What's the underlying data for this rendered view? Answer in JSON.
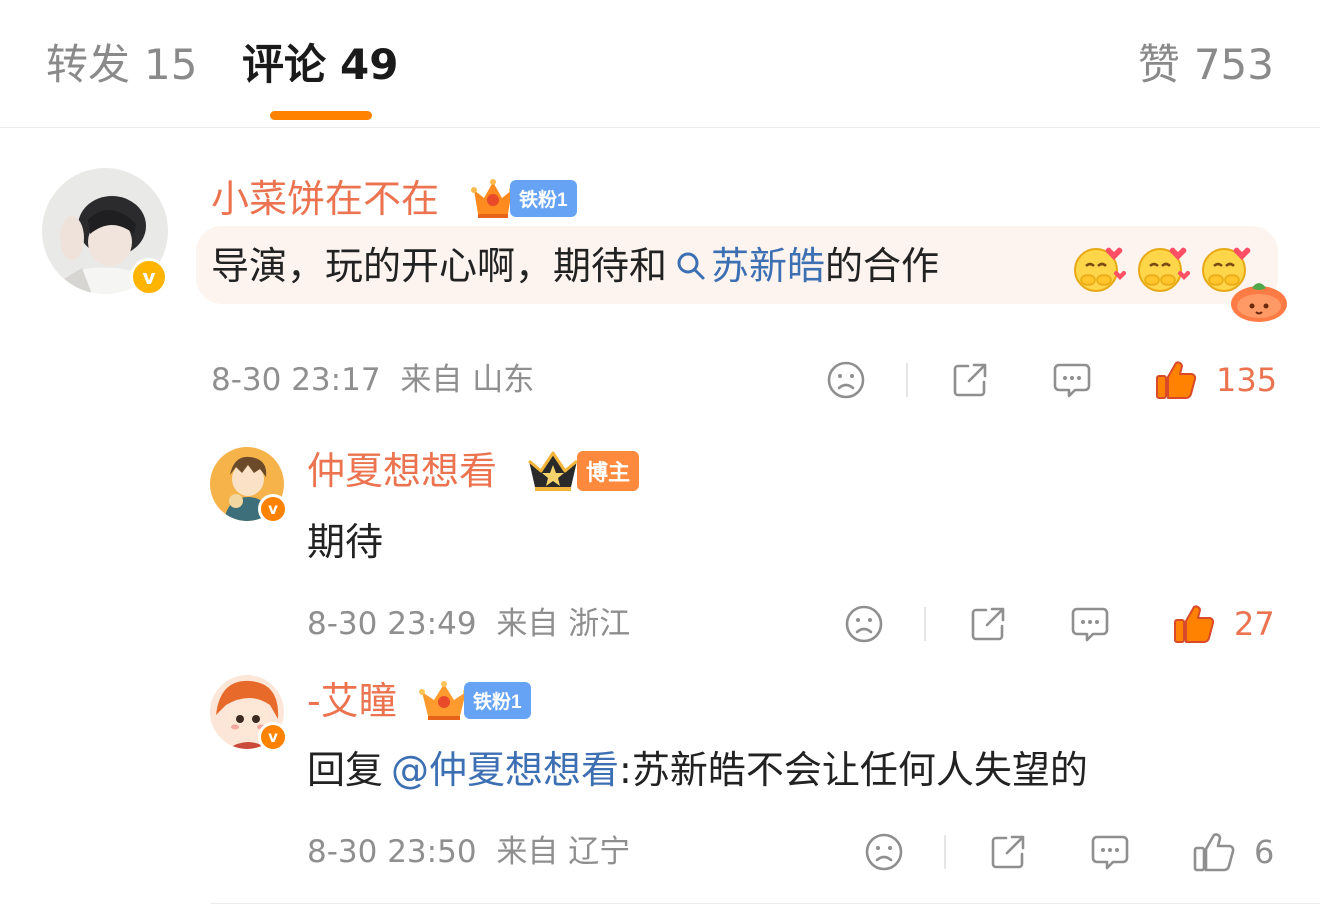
{
  "tabs": {
    "repost_label": "转发",
    "repost_count": "15",
    "comment_label": "评论",
    "comment_count": "49",
    "like_label": "赞",
    "like_count": "753"
  },
  "colors": {
    "accent": "#ff8200",
    "username": "#eb7350",
    "link": "#3d6fb3",
    "fan_badge": "#66a3f5"
  },
  "comments": [
    {
      "username": "小菜饼在不在",
      "badge": "铁粉1",
      "text_before": "导演，玩的开心啊，期待和",
      "mention_icon": "search-icon",
      "mention": "苏新皓",
      "text_after": "的合作",
      "emojis": [
        "hug-emoji",
        "hug-emoji",
        "hug-emoji"
      ],
      "time": "8-30 23:17",
      "source": "来自 山东",
      "likes": "135",
      "liked": true
    },
    {
      "username": "仲夏想想看",
      "badge": "博主",
      "text": "期待",
      "time": "8-30 23:49",
      "source": "来自 浙江",
      "likes": "27",
      "liked": true
    },
    {
      "username": "-艾瞳",
      "badge": "铁粉1",
      "reply_prefix": "回复",
      "reply_to": "@仲夏想想看",
      "text": ":苏新皓不会让任何人失望的",
      "time": "8-30 23:50",
      "source": "来自 辽宁",
      "likes": "6",
      "liked": false
    }
  ]
}
